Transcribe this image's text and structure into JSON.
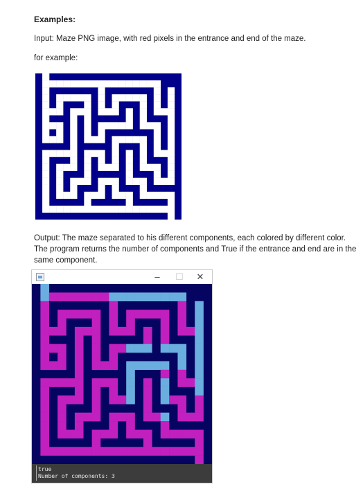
{
  "doc": {
    "heading": "Examples:",
    "input_line": "Input: Maze PNG image, with red pixels in the entrance and end of the maze.",
    "for_example": "for example:",
    "output_paragraph": "Output: The maze separated to his different components, each colored by different color. The program returns the number of components and True if the entrance and end are in the same component."
  },
  "window": {
    "title": "",
    "icon": "java-app-icon",
    "minimize_glyph": "–",
    "maximize_glyph": "☐",
    "close_glyph": "✕",
    "console_lines": [
      "true",
      "Number of components: 3"
    ]
  },
  "colors": {
    "maze_wall": "#00008b",
    "maze_path": "#ffffff",
    "component_wall": "#050561",
    "component_magenta": "#c21fbf",
    "component_lightblue": "#6aaedf",
    "console_bg": "#3c3c3c"
  }
}
